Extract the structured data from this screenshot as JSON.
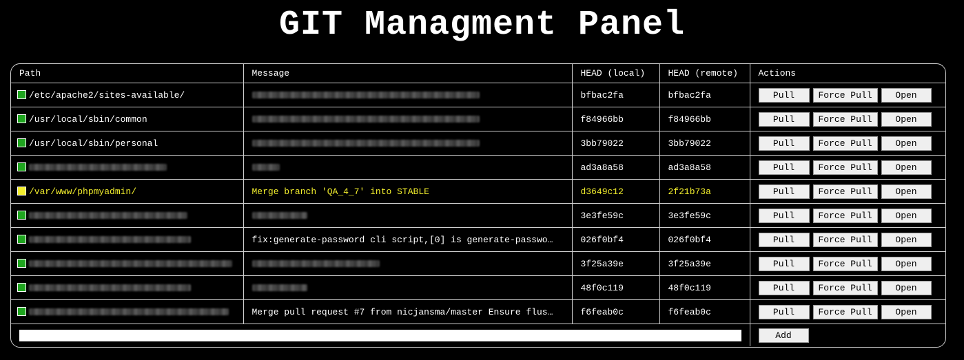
{
  "page": {
    "title": "GIT Managment Panel"
  },
  "colors": {
    "status_ok": "#1fa51f",
    "status_warn": "#f2ee2d",
    "accent_text": "#f2ee2d",
    "background": "#000000",
    "foreground": "#ffffff"
  },
  "table": {
    "headers": {
      "path": "Path",
      "message": "Message",
      "head_local": "HEAD (local)",
      "head_remote": "HEAD (remote)",
      "actions": "Actions"
    },
    "buttons": {
      "pull": "Pull",
      "force_pull": "Force Pull",
      "open": "Open",
      "add": "Add"
    },
    "rows": [
      {
        "path": "/etc/apache2/sites-available/",
        "message": "",
        "head_local": "bfbac2fa",
        "head_remote": "bfbac2fa",
        "status": "ok"
      },
      {
        "path": "/usr/local/sbin/common",
        "message": "",
        "head_local": "f84966bb",
        "head_remote": "f84966bb",
        "status": "ok"
      },
      {
        "path": "/usr/local/sbin/personal",
        "message": "",
        "head_local": "3bb79022",
        "head_remote": "3bb79022",
        "status": "ok"
      },
      {
        "path": "",
        "message": "",
        "head_local": "ad3a8a58",
        "head_remote": "ad3a8a58",
        "status": "ok"
      },
      {
        "path": "/var/www/phpmyadmin/",
        "message": "Merge branch 'QA_4_7' into STABLE",
        "head_local": "d3649c12",
        "head_remote": "2f21b73a",
        "status": "warn"
      },
      {
        "path": "",
        "message": "",
        "head_local": "3e3fe59c",
        "head_remote": "3e3fe59c",
        "status": "ok"
      },
      {
        "path": "",
        "message": "fix:generate-password cli script,[0] is generate-passwo…",
        "head_local": "026f0bf4",
        "head_remote": "026f0bf4",
        "status": "ok"
      },
      {
        "path": "",
        "message": "",
        "head_local": "3f25a39e",
        "head_remote": "3f25a39e",
        "status": "ok"
      },
      {
        "path": "",
        "message": "",
        "head_local": "48f0c119",
        "head_remote": "48f0c119",
        "status": "ok"
      },
      {
        "path": "",
        "message": "Merge pull request #7 from nicjansma/master Ensure flus…",
        "head_local": "f6feab0c",
        "head_remote": "f6feab0c",
        "status": "ok"
      }
    ],
    "add_input": {
      "value": "",
      "placeholder": ""
    }
  }
}
